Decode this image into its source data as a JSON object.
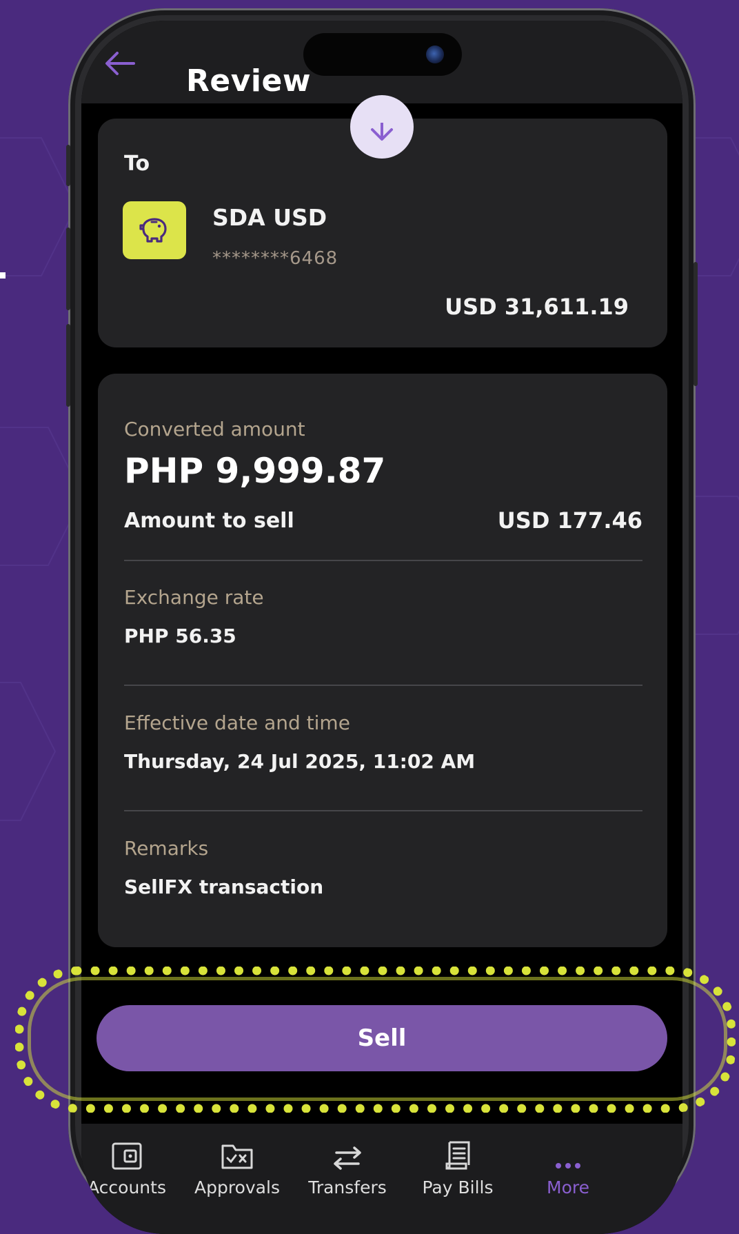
{
  "header": {
    "title": "Review"
  },
  "destination": {
    "label": "To",
    "account_name": "SDA USD",
    "account_number": "********6468",
    "balance": "USD 31,611.19"
  },
  "details": {
    "converted_amount_label": "Converted amount",
    "converted_amount_value": "PHP 9,999.87",
    "amount_to_sell_label": "Amount to sell",
    "amount_to_sell_value": "USD 177.46",
    "exchange_rate_label": "Exchange rate",
    "exchange_rate_value": "PHP 56.35",
    "effective_date_label": "Effective date and time",
    "effective_date_value": "Thursday, 24 Jul 2025, 11:02 AM",
    "remarks_label": "Remarks",
    "remarks_value": "SellFX transaction"
  },
  "actions": {
    "sell_label": "Sell"
  },
  "tabbar": {
    "items": [
      {
        "label": "Accounts",
        "icon": "wallet-icon"
      },
      {
        "label": "Approvals",
        "icon": "approvals-folder-icon"
      },
      {
        "label": "Transfers",
        "icon": "transfer-arrows-icon"
      },
      {
        "label": "Pay Bills",
        "icon": "receipt-icon"
      },
      {
        "label": "More",
        "icon": "more-dots-icon",
        "active": true
      }
    ]
  },
  "colors": {
    "background": "#4a2a7e",
    "accent": "#7a56a8",
    "highlight": "#d8e33a",
    "account_icon": "#dce44a",
    "active_tab": "#8a5fd0"
  }
}
